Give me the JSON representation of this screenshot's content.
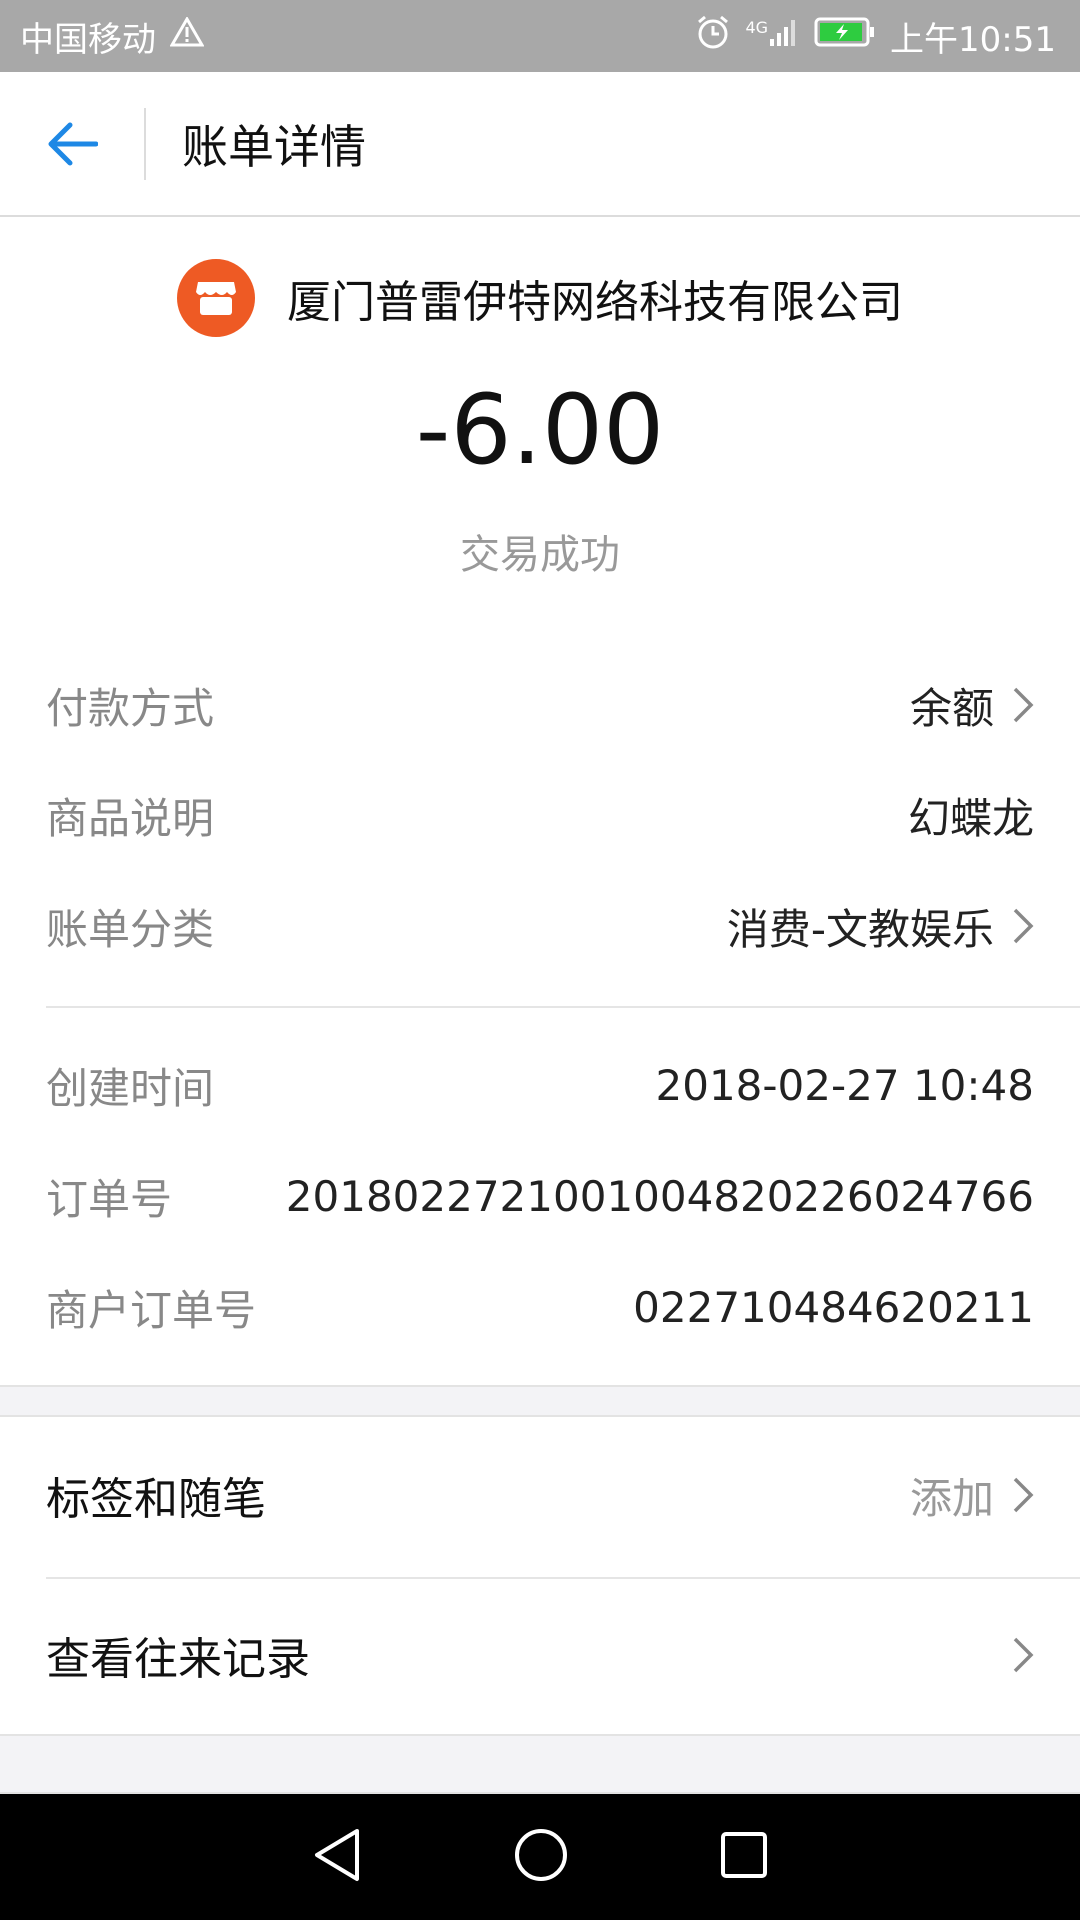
{
  "status_bar": {
    "carrier": "中国移动",
    "warning_icon": "warning-triangle-icon",
    "alarm_icon": "alarm-clock-icon",
    "network": "4G",
    "signal_icon": "signal-bars-icon",
    "battery_icon": "battery-charging-icon",
    "time": "上午10:51"
  },
  "nav": {
    "back_icon": "arrow-left-icon",
    "title": "账单详情",
    "accent_color": "#1e88e5"
  },
  "header": {
    "merchant_icon": "store-icon",
    "merchant_color": "#ee5a24",
    "merchant_name": "厦门普雷伊特网络科技有限公司",
    "amount": "-6.00",
    "status": "交易成功"
  },
  "details": {
    "payment_method": {
      "label": "付款方式",
      "value": "余额"
    },
    "product_desc": {
      "label": "商品说明",
      "value": "幻蝶龙"
    },
    "bill_category": {
      "label": "账单分类",
      "value": "消费-文教娱乐"
    },
    "created_time": {
      "label": "创建时间",
      "value": "2018-02-27 10:48"
    },
    "order_no": {
      "label": "订单号",
      "value": "2018022721001004820226024766"
    },
    "merchant_order_no": {
      "label": "商户订单号",
      "value": "022710484620211"
    }
  },
  "extras": {
    "tags_notes": {
      "label": "标签和随笔",
      "action": "添加"
    },
    "history": {
      "label": "查看往来记录"
    }
  },
  "system_nav": {
    "back_icon": "triangle-back-icon",
    "home_icon": "circle-home-icon",
    "recents_icon": "square-recents-icon"
  }
}
